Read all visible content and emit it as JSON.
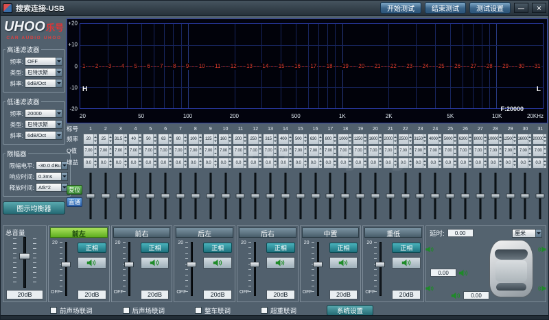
{
  "watermark": "UHOO乐号",
  "colors": {
    "speaker_green": "#1e8a28",
    "band_marker_red": "#e03c2c",
    "active_channel_green": "#76c52a"
  },
  "titlebar": {
    "title": "搜索连接-USB",
    "start_test": "开始测试",
    "end_test": "结束测试",
    "test_settings": "测试设置",
    "minimize": "—",
    "close": "✕"
  },
  "sidebar": {
    "logo_en": "UHOO",
    "logo_cn": "乐号",
    "tagline": "CAR AUDIO UHOO",
    "hpf": {
      "title": "高通滤波器",
      "fields": [
        {
          "label": "频率:",
          "value": "OFF"
        },
        {
          "label": "类型:",
          "value": "巴特沃斯"
        },
        {
          "label": "斜率:",
          "value": "6dB/Oct"
        }
      ]
    },
    "lpf": {
      "title": "低通滤波器",
      "fields": [
        {
          "label": "频率:",
          "value": "20000"
        },
        {
          "label": "类型:",
          "value": "巴特沃斯"
        },
        {
          "label": "斜率:",
          "value": "6dB/Oct"
        }
      ]
    },
    "limiter": {
      "title": "限幅器",
      "fields": [
        {
          "label": "限幅电平:",
          "value": "-30.0 dBu"
        },
        {
          "label": "响应时间:",
          "value": "0.3ms"
        },
        {
          "label": "释放时间:",
          "value": "Atk*2"
        }
      ]
    },
    "eq_button": "图示均衡器"
  },
  "graph": {
    "y_ticks": [
      "+20",
      "+10",
      "0",
      "-10",
      "-20"
    ],
    "x_ticks": [
      {
        "label": "20",
        "f": 20
      },
      {
        "label": "50",
        "f": 50
      },
      {
        "label": "100",
        "f": 100
      },
      {
        "label": "200",
        "f": 200
      },
      {
        "label": "500",
        "f": 500
      },
      {
        "label": "1K",
        "f": 1000
      },
      {
        "label": "2K",
        "f": 2000
      },
      {
        "label": "5K",
        "f": 5000
      },
      {
        "label": "10K",
        "f": 10000
      },
      {
        "label": "20KHz",
        "f": 20000
      }
    ],
    "hp_handle": "H",
    "lp_handle": "L",
    "freq_readout": "F:20000"
  },
  "eq": {
    "row_labels": [
      "标号",
      "频率",
      "Q值",
      "增益"
    ],
    "reset": "复位",
    "bypass": "直通",
    "bands": [
      {
        "id": "1",
        "freq": "20",
        "q": "7.00",
        "gain": "0.0"
      },
      {
        "id": "2",
        "freq": "25",
        "q": "7.00",
        "gain": "0.0"
      },
      {
        "id": "3",
        "freq": "31.5",
        "q": "7.00",
        "gain": "0.0"
      },
      {
        "id": "4",
        "freq": "40",
        "q": "7.00",
        "gain": "0.0"
      },
      {
        "id": "5",
        "freq": "50",
        "q": "7.00",
        "gain": "0.0"
      },
      {
        "id": "6",
        "freq": "63",
        "q": "7.00",
        "gain": "0.0"
      },
      {
        "id": "7",
        "freq": "80",
        "q": "7.00",
        "gain": "0.0"
      },
      {
        "id": "8",
        "freq": "100",
        "q": "7.00",
        "gain": "0.0"
      },
      {
        "id": "9",
        "freq": "125",
        "q": "7.00",
        "gain": "0.0"
      },
      {
        "id": "10",
        "freq": "160",
        "q": "7.00",
        "gain": "0.0"
      },
      {
        "id": "11",
        "freq": "200",
        "q": "7.00",
        "gain": "0.0"
      },
      {
        "id": "12",
        "freq": "250",
        "q": "7.00",
        "gain": "0.0"
      },
      {
        "id": "13",
        "freq": "315",
        "q": "7.00",
        "gain": "0.0"
      },
      {
        "id": "14",
        "freq": "400",
        "q": "7.00",
        "gain": "0.0"
      },
      {
        "id": "15",
        "freq": "500",
        "q": "7.00",
        "gain": "0.0"
      },
      {
        "id": "16",
        "freq": "630",
        "q": "7.00",
        "gain": "0.0"
      },
      {
        "id": "17",
        "freq": "800",
        "q": "7.00",
        "gain": "0.0"
      },
      {
        "id": "18",
        "freq": "1000",
        "q": "7.00",
        "gain": "0.0"
      },
      {
        "id": "19",
        "freq": "1250",
        "q": "7.00",
        "gain": "0.0"
      },
      {
        "id": "20",
        "freq": "1600",
        "q": "7.00",
        "gain": "0.0"
      },
      {
        "id": "21",
        "freq": "2000",
        "q": "7.00",
        "gain": "0.0"
      },
      {
        "id": "22",
        "freq": "2500",
        "q": "7.00",
        "gain": "0.0"
      },
      {
        "id": "23",
        "freq": "3150",
        "q": "7.00",
        "gain": "0.0"
      },
      {
        "id": "24",
        "freq": "4000",
        "q": "7.00",
        "gain": "0.0"
      },
      {
        "id": "25",
        "freq": "5000",
        "q": "7.00",
        "gain": "0.0"
      },
      {
        "id": "26",
        "freq": "6300",
        "q": "7.00",
        "gain": "0.0"
      },
      {
        "id": "27",
        "freq": "8000",
        "q": "7.00",
        "gain": "0.0"
      },
      {
        "id": "28",
        "freq": "10000",
        "q": "7.00",
        "gain": "0.0"
      },
      {
        "id": "29",
        "freq": "12500",
        "q": "7.00",
        "gain": "0.0"
      },
      {
        "id": "30",
        "freq": "16000",
        "q": "7.00",
        "gain": "0.0"
      },
      {
        "id": "31",
        "freq": "20000",
        "q": "7.00",
        "gain": "0.0"
      }
    ]
  },
  "master": {
    "title": "总音量",
    "gain": "20dB"
  },
  "channel_scale": {
    "top": "20",
    "bottom": "OFF"
  },
  "channels": [
    {
      "id": "front-left",
      "label": "前左",
      "phase": "正相",
      "gain": "20dB",
      "active": true
    },
    {
      "id": "front-right",
      "label": "前右",
      "phase": "正相",
      "gain": "20dB",
      "active": false
    },
    {
      "id": "rear-left",
      "label": "后左",
      "phase": "正相",
      "gain": "20dB",
      "active": false
    },
    {
      "id": "rear-right",
      "label": "后右",
      "phase": "正相",
      "gain": "20dB",
      "active": false
    },
    {
      "id": "center",
      "label": "中置",
      "phase": "正相",
      "gain": "20dB",
      "active": false
    },
    {
      "id": "subwoofer",
      "label": "重低",
      "phase": "正相",
      "gain": "20dB",
      "active": false
    }
  ],
  "delay": {
    "title": "延时:",
    "main_value": "0.00",
    "unit": "厘米",
    "left_value": "0.00",
    "bottom_value": "0.00"
  },
  "footer": {
    "checkboxes": [
      "前声场联调",
      "后声场联调",
      "整车联调",
      "超重联调"
    ],
    "settings": "系统设置"
  }
}
